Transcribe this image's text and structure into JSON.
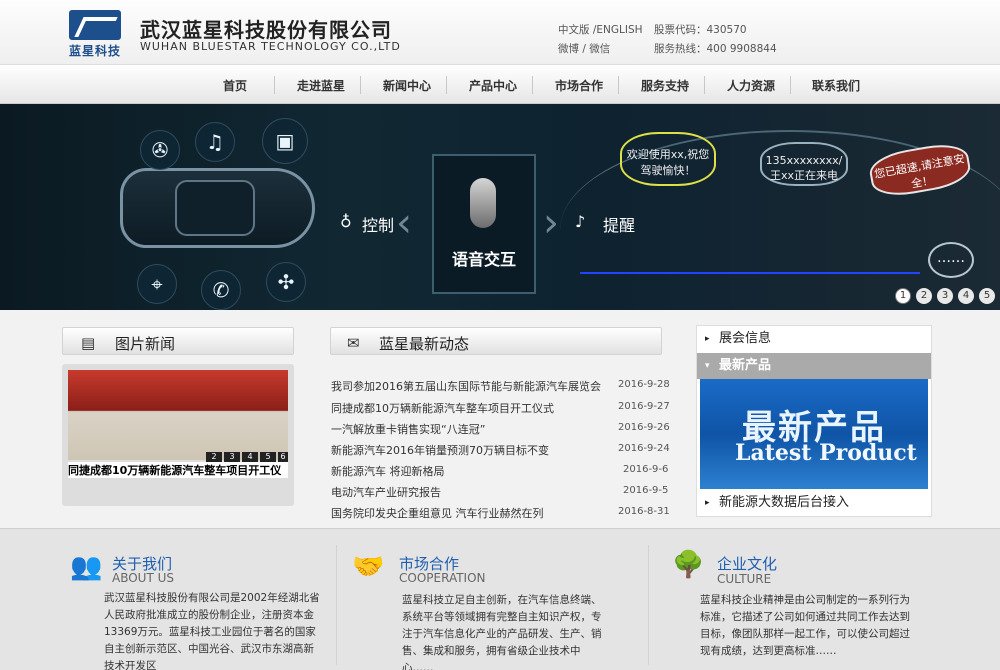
{
  "header": {
    "logo_text": "蓝星科技",
    "company_cn": "武汉蓝星科技股份有限公司",
    "company_en": "WUHAN BLUESTAR TECHNOLOGY CO.,LTD",
    "lang": "中文版 /ENGLISH",
    "social": "微博 / 微信",
    "stock": "股票代码：430570",
    "hotline": "服务热线：400 9908844"
  },
  "nav": [
    "首页",
    "走进蓝星",
    "新闻中心",
    "产品中心",
    "市场合作",
    "服务支持",
    "人力资源",
    "联系我们"
  ],
  "banner": {
    "left_label": "控制",
    "center_label": "语音交互",
    "right_label": "提醒",
    "bubble1": "欢迎使用xx,祝您驾驶愉快！",
    "bubble2": "135xxxxxxxx/王xx正在来电",
    "bubble3": "您已超速,请注意安全！",
    "dots": "……",
    "pages": [
      "1",
      "2",
      "3",
      "4",
      "5"
    ],
    "active_page": "1"
  },
  "photo_news": {
    "title": "图片新闻",
    "caption": "同捷成都10万辆新能源汽车整车项目开工仪",
    "pages": [
      "2",
      "3",
      "4",
      "5",
      "6"
    ]
  },
  "latest_news": {
    "title": "蓝星最新动态",
    "items": [
      {
        "text": "我司参加2016第五届山东国际节能与新能源汽车展览会",
        "date": "2016-9-28"
      },
      {
        "text": "同捷成都10万辆新能源汽车整车项目开工仪式",
        "date": "2016-9-27"
      },
      {
        "text": "一汽解放重卡销售实现“八连冠”",
        "date": "2016-9-26"
      },
      {
        "text": "新能源汽车2016年销量预测70万辆目标不变",
        "date": "2016-9-24"
      },
      {
        "text": "新能源汽车 将迎新格局",
        "date": "2016-9-6"
      },
      {
        "text": "电动汽车产业研究报告",
        "date": "2016-9-5"
      },
      {
        "text": "国务院印发央企重组意见 汽车行业赫然在列",
        "date": "2016-8-31"
      }
    ]
  },
  "right_panel": {
    "items": [
      "展会信息",
      "最新产品",
      "新能源大数据后台接入"
    ],
    "selected": "最新产品",
    "prod_cn": "最新产品",
    "prod_en": "Latest Product"
  },
  "footer": {
    "about": {
      "title": "关于我们",
      "sub": "ABOUT US",
      "lines": [
        "武汉蓝星科技股份有限公司是2002年经湖北省",
        "人民政府批准成立的股份制企业，注册资本金",
        "13369万元。蓝星科技工业园位于著名的国家",
        "自主创新示范区、中国光谷、武汉市东湖高新",
        "技术开发区"
      ]
    },
    "coop": {
      "title": "市场合作",
      "sub": "COOPERATION",
      "lines": [
        "蓝星科技立足自主创新，在汽车信息终端、",
        "系统平台等领域拥有完整自主知识产权，专",
        "注于汽车信息化产业的产品研发、生产、销",
        "售、集成和服务，拥有省级企业技术中",
        "心……"
      ]
    },
    "culture": {
      "title": "企业文化",
      "sub": "CULTURE",
      "lines": [
        "蓝星科技企业精神是由公司制定的一系列行为",
        "标准，它描述了公司如何通过共同工作去达到",
        "目标，像团队那样一起工作，可以使公司超过",
        "现有成绩，达到更高标准……"
      ]
    }
  },
  "colors": {
    "accent": "#1e5fb0",
    "logo": "#1d4f8c"
  }
}
